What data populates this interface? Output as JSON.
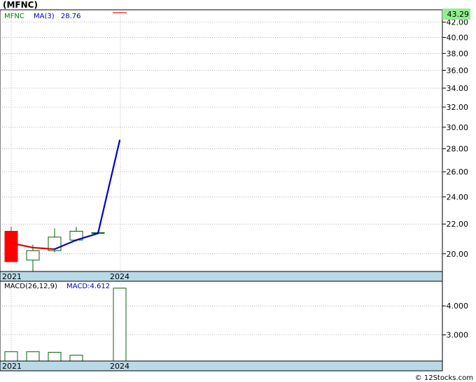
{
  "ticker_title": "(MFNC)",
  "credit": "© 12Stocks.com",
  "colors": {
    "panel_border": "#000000",
    "gridline": "#999999",
    "date_band": "#b9d9e6",
    "candle_up_fill": "#ffffff",
    "candle_up_stroke": "#006400",
    "candle_down_fill": "#ff0000",
    "ma_rising": "#0000cc",
    "ma_falling": "#dd0000",
    "last_price_box": "#90ee90",
    "ma_legend": "#0000cc",
    "ticker_legend": "#008000",
    "macd_bar_stroke": "#006400"
  },
  "chart_data": [
    {
      "type": "candlestick",
      "legend": {
        "ticker": "MFNC",
        "ma_label": "MA(3)",
        "ma_value": "28.76"
      },
      "y_ticks": [
        "20.00",
        "22.00",
        "24.00",
        "26.00",
        "28.00",
        "30.00",
        "32.00",
        "34.00",
        "36.00",
        "38.00",
        "40.00",
        "42.00"
      ],
      "y_tick_values": [
        20,
        22,
        24,
        26,
        28,
        30,
        32,
        34,
        36,
        38,
        40,
        42
      ],
      "x_labels": [
        {
          "label": "2021",
          "index": 0
        },
        {
          "label": "2024",
          "index": 5
        }
      ],
      "last_price": "43.29",
      "last_price_value": 43.29,
      "scale": "log",
      "ylim": [
        18.9,
        43.7
      ],
      "candles": [
        {
          "open": 21.5,
          "high": 21.8,
          "low": 19.5,
          "close": 19.5
        },
        {
          "open": 19.6,
          "high": 20.6,
          "low": 18.9,
          "close": 20.2
        },
        {
          "open": 20.2,
          "high": 21.7,
          "low": 20.1,
          "close": 21.1
        },
        {
          "open": 20.9,
          "high": 21.8,
          "low": 20.8,
          "close": 21.5
        },
        {
          "open": 21.4,
          "high": 21.5,
          "low": 21.3,
          "close": 21.4
        },
        {
          "open": 43.29,
          "high": 43.29,
          "low": 43.29,
          "close": 43.29
        }
      ],
      "ma": [
        {
          "index": 0,
          "value": 20.7
        },
        {
          "index": 1,
          "value": 20.4
        },
        {
          "index": 2,
          "value": 20.3
        },
        {
          "index": 3,
          "value": 20.9
        },
        {
          "index": 4,
          "value": 21.35
        },
        {
          "index": 5,
          "value": 28.76
        }
      ]
    },
    {
      "type": "bar",
      "legend": {
        "params": "MACD(26,12,9)",
        "macd_label": "MACD:4.612"
      },
      "y_ticks": [
        "3.000",
        "4.000"
      ],
      "y_tick_values": [
        3.0,
        4.0
      ],
      "x_labels": [
        {
          "label": "2021",
          "index": 0
        },
        {
          "label": "2024",
          "index": 5
        }
      ],
      "ylim": [
        2.1,
        4.85
      ],
      "values": [
        2.42,
        2.42,
        2.4,
        2.3,
        null,
        4.612
      ]
    }
  ]
}
